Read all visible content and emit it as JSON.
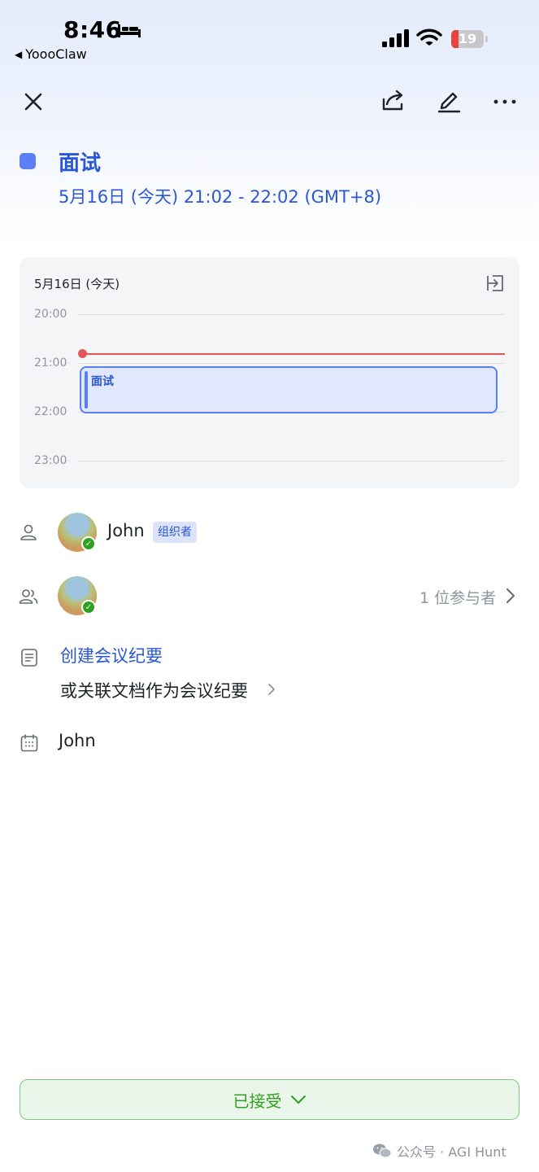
{
  "status_bar": {
    "time": "8:46",
    "back_app": "YoooClaw",
    "battery": "19",
    "icons": [
      "bed-icon",
      "signal-icon",
      "wifi-icon",
      "battery-icon"
    ]
  },
  "toolbar": {
    "icons": [
      "close-icon",
      "share-icon",
      "edit-icon",
      "more-icon"
    ]
  },
  "event": {
    "title": "面试",
    "time_range": "5月16日 (今天) 21:02 - 22:02 (GMT+8)",
    "color": "#5b7ff2"
  },
  "mini_calendar": {
    "date": "5月16日 (今天)",
    "hours": [
      "20:00",
      "21:00",
      "22:00",
      "23:00"
    ],
    "event_label": "面试",
    "now_line_color": "#e35757"
  },
  "organizer": {
    "name": "John",
    "badge": "组织者"
  },
  "attendees": {
    "count_label": "1 位参与者"
  },
  "notes": {
    "create": "创建会议纪要",
    "link_doc": "或关联文档作为会议纪要"
  },
  "calendar": {
    "owner": "John"
  },
  "rsvp": {
    "label": "已接受",
    "color": "#2ea121"
  },
  "watermark": {
    "text": "公众号 · AGI Hunt"
  }
}
